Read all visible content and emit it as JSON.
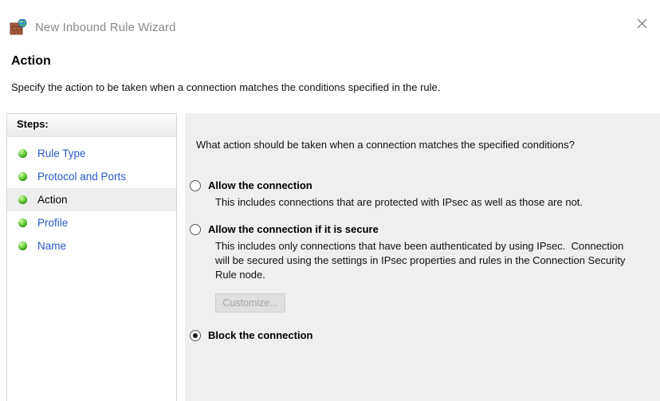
{
  "window": {
    "title": "New Inbound Rule Wizard",
    "icon": "firewall-globe-icon",
    "close_label": "✕"
  },
  "header": {
    "heading": "Action",
    "subtitle": "Specify the action to be taken when a connection matches the conditions specified in the rule."
  },
  "sidebar": {
    "header": "Steps:",
    "items": [
      {
        "label": "Rule Type",
        "current": false
      },
      {
        "label": "Protocol and Ports",
        "current": false
      },
      {
        "label": "Action",
        "current": true
      },
      {
        "label": "Profile",
        "current": false
      },
      {
        "label": "Name",
        "current": false
      }
    ]
  },
  "main": {
    "question": "What action should be taken when a connection matches the specified conditions?",
    "options": [
      {
        "id": "allow",
        "title": "Allow the connection",
        "description": "This includes connections that are protected with IPsec as well as those are not.",
        "selected": false
      },
      {
        "id": "allow-if-secure",
        "title": "Allow the connection if it is secure",
        "description": "This includes only connections that have been authenticated by using IPsec.  Connection\nwill be secured using the settings in IPsec properties and rules in the Connection Security\nRule node.",
        "selected": false,
        "button": {
          "label": "Customize...",
          "disabled": true
        }
      },
      {
        "id": "block",
        "title": "Block the connection",
        "description": "",
        "selected": true
      }
    ]
  },
  "colors": {
    "link": "#2a58c8",
    "panel_background": "#efefef",
    "step_bullet": "#3fae1c",
    "title_text": "#8a8a8a"
  }
}
